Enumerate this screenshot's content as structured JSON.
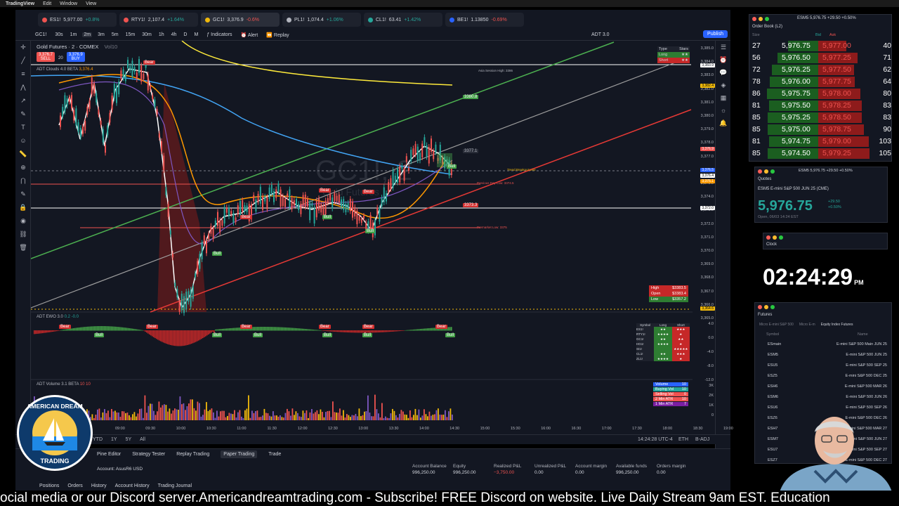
{
  "macbar": {
    "app": "TradingView",
    "menus": [
      "Edit",
      "Window",
      "View"
    ]
  },
  "tabs": [
    {
      "sym": "ES1!",
      "price": "5,977.00",
      "chg": "+0.8%",
      "color": "#ef5350",
      "dir": "up"
    },
    {
      "sym": "RTY1!",
      "price": "2,107.4",
      "chg": "+1.64%",
      "color": "#ef5350",
      "dir": "up"
    },
    {
      "sym": "GC1!",
      "price": "3,376.9",
      "chg": "-0.6%",
      "color": "#f0b90b",
      "dir": "dn"
    },
    {
      "sym": "PL1!",
      "price": "1,074.4",
      "chg": "+1.06%",
      "color": "#b2b5be",
      "dir": "up"
    },
    {
      "sym": "CL1!",
      "price": "63.41",
      "chg": "+1.42%",
      "color": "#26a69a",
      "dir": "up"
    },
    {
      "sym": "BE1!",
      "price": "1.13850",
      "chg": "-0.69%",
      "color": "#2962ff",
      "dir": "dn"
    }
  ],
  "toolbar": {
    "symbol": "GC1!",
    "intervals": [
      "30s",
      "1m",
      "2m",
      "3m",
      "5m",
      "15m",
      "30m",
      "1h",
      "4h",
      "D",
      "M"
    ],
    "selected_interval": "2m",
    "indicators": "Indicators",
    "alert": "Alert",
    "replay": "Replay",
    "layout": "ADT 3.0",
    "publish": "Publish"
  },
  "chart": {
    "title": "Gold Futures · 2 · COMEX",
    "sell_price": "3,376.7",
    "sell": "SELL",
    "qty": "20",
    "buy_price": "3,376.9",
    "buy": "BUY",
    "vol_label": "Vol10",
    "ind1": "ADT Clouds 4.0 BETA",
    "ind1_val": "3,376.4",
    "watermark": "GC1!, 2",
    "watermark_sub": "Gold Futures",
    "ind2": "ADT EWO 3.0",
    "ind2_vals": "0.2  -0.0",
    "ind3": "ADT Volume 3.1 BETA",
    "ind3_vals": "10  10",
    "line_labels": {
      "l1": "3380.8",
      "l2": "3377.1",
      "l3": "3373.3",
      "prev_day_low": "Previous Day Low: 3374.5",
      "premarket_low": "Premarket Low: 3375",
      "asia_high": "Asia Session High: 3386",
      "trend": "Trend Breakout Line"
    },
    "price_axis": [
      "3,385.0",
      "3,384.0",
      "3,383.0",
      "3,382.0",
      "3,381.0",
      "3,380.0",
      "3,379.0",
      "3,378.0",
      "3,377.0",
      "3,376.0",
      "3,375.0",
      "3,374.0",
      "3,373.0",
      "3,372.0",
      "3,371.0",
      "3,370.0",
      "3,369.0",
      "3,368.0",
      "3,367.0",
      "3,366.0",
      "3,365.0"
    ],
    "axis_labels": {
      "a": "3,383.9",
      "b": "3,382.4",
      "c": "3,376.9",
      "d": "3,376.5",
      "e": "3,376.4",
      "f": "3,375.1",
      "g": "3,372.0",
      "h": "3,364.6"
    },
    "ewo_axis": [
      "4.0",
      "0.0",
      "-4.0",
      "-8.0",
      "-12.0"
    ],
    "vol_axis": [
      "3K",
      "2K",
      "1K",
      "0"
    ],
    "time_axis": [
      "09:00",
      "09:30",
      "10:00",
      "10:30",
      "11:00",
      "11:30",
      "12:00",
      "12:30",
      "13:00",
      "13:30",
      "14:00",
      "14:30",
      "15:00",
      "15:30",
      "16:00",
      "16:30",
      "17:00",
      "17:30",
      "18:00",
      "18:30",
      "19:00"
    ],
    "hol": {
      "high_label": "High",
      "high": "$3383.5",
      "open_label": "Open",
      "open": "$3383.4",
      "low_label": "Low",
      "low": "$3357.2"
    },
    "stars": {
      "type": "Type",
      "stars": "Stars",
      "long": "Long",
      "short": "Short",
      "long_stars": "★★",
      "short_stars": "★★"
    },
    "vol_box": [
      {
        "label": "Volume",
        "val": "10",
        "bg": "#2962ff"
      },
      {
        "label": "Buying Vol",
        "val": "10",
        "bg": "#26a69a"
      },
      {
        "label": "Selling Vol",
        "val": "0",
        "bg": "#ef5350"
      },
      {
        "label": "2 Min ATR",
        "val": "10",
        "bg": "#ef5350"
      },
      {
        "label": "1 Min ATR",
        "val": "7",
        "bg": "#7b1fa2"
      }
    ],
    "symtable": {
      "head": [
        "Symbol",
        "Long",
        "Short"
      ],
      "rows": [
        [
          "ES1!",
          "★★",
          "★★★"
        ],
        [
          "RTY1!",
          "★★★★",
          "★"
        ],
        [
          "GC1!",
          "★★",
          "★★"
        ],
        [
          "HG1!",
          "★★★★",
          "★"
        ],
        [
          "SI1!",
          "",
          "★★★★★"
        ],
        [
          "CL1!",
          "★★",
          "★★★"
        ],
        [
          "ZL1!",
          "★★★★",
          "★"
        ]
      ]
    },
    "signals": {
      "bear": "Bear",
      "bull": "Bull"
    }
  },
  "bottombar": {
    "ranges": [
      "YTD",
      "1Y",
      "5Y",
      "All"
    ],
    "time": "14:24:28 UTC-4",
    "session": "ETH",
    "adj": "B-ADJ"
  },
  "panel": {
    "tabs": [
      "Pine Editor",
      "Strategy Tester",
      "Replay Trading",
      "Paper Trading",
      "Trade"
    ],
    "account_label": "Account: AsusR6 USD",
    "metrics": [
      {
        "label": "Account Balance",
        "val": "996,250.00"
      },
      {
        "label": "Equity",
        "val": "996,250.00"
      },
      {
        "label": "Realized P&L",
        "val": "−3,750.00"
      },
      {
        "label": "Unrealized P&L",
        "val": "0.00"
      },
      {
        "label": "Account margin",
        "val": "0.00"
      },
      {
        "label": "Available funds",
        "val": "996,250.00"
      },
      {
        "label": "Orders margin",
        "val": "0.00"
      }
    ],
    "subtabs": [
      "Positions",
      "Orders",
      "History",
      "Account History",
      "Trading Journal"
    ]
  },
  "orderbook": {
    "window_title": "ESM5 5,976.75 +29.50 +0.50%",
    "title": "Order Book (L2)",
    "cols": [
      "Size",
      "Bid",
      "Ask"
    ],
    "rows": [
      {
        "bsize": "27",
        "bid": "5,976.75",
        "ask": "5,977.00",
        "asize": "40"
      },
      {
        "bsize": "56",
        "bid": "5,976.50",
        "ask": "5,977.25",
        "asize": "71"
      },
      {
        "bsize": "72",
        "bid": "5,976.25",
        "ask": "5,977.50",
        "asize": "62"
      },
      {
        "bsize": "78",
        "bid": "5,976.00",
        "ask": "5,977.75",
        "asize": "64"
      },
      {
        "bsize": "86",
        "bid": "5,975.75",
        "ask": "5,978.00",
        "asize": "80"
      },
      {
        "bsize": "81",
        "bid": "5,975.50",
        "ask": "5,978.25",
        "asize": "83"
      },
      {
        "bsize": "85",
        "bid": "5,975.25",
        "ask": "5,978.50",
        "asize": "83"
      },
      {
        "bsize": "85",
        "bid": "5,975.00",
        "ask": "5,978.75",
        "asize": "90"
      },
      {
        "bsize": "81",
        "bid": "5,974.75",
        "ask": "5,979.00",
        "asize": "103"
      },
      {
        "bsize": "85",
        "bid": "5,974.50",
        "ask": "5,979.25",
        "asize": "105"
      }
    ]
  },
  "quotes": {
    "window_title": "ESM5 5,976.75 +29.50 +0.50%",
    "title": "Quotes",
    "desc": "ESM5 E-mini S&P 500 JUN 25 (CME)",
    "price": "5,976.75",
    "chg": "+29.50",
    "pct": "+0.50%",
    "status": "Open, 06/03 14:24 EST"
  },
  "clock": {
    "title": "Clock",
    "time": "02:24:29",
    "ampm": "PM"
  },
  "futures": {
    "title": "Futures",
    "filters": [
      "Micro E-mini S&P 500",
      "Micro E-m",
      "Equity Index Futures"
    ],
    "head": [
      "Symbol",
      "Name"
    ],
    "rows": [
      [
        "ESmain",
        "E-mini S&P 500 Main JUN 25"
      ],
      [
        "ESM5",
        "E-mini S&P 500 JUN 25"
      ],
      [
        "ESU5",
        "E-mini S&P 500 SEP 25"
      ],
      [
        "ESZ5",
        "E-mini S&P 500 DEC 25"
      ],
      [
        "ESH6",
        "E-mini S&P 500 MAR 26"
      ],
      [
        "ESM6",
        "E-mini S&P 500 JUN 26"
      ],
      [
        "ESU6",
        "E-mini S&P 500 SEP 26"
      ],
      [
        "ESZ6",
        "E-mini S&P 500 DEC 26"
      ],
      [
        "ESH7",
        "E-mini S&P 500 MAR 27"
      ],
      [
        "ESM7",
        "E-mini S&P 500 JUN 27"
      ],
      [
        "ESU7",
        "E-mini S&P 500 SEP 27"
      ],
      [
        "ESZ7",
        "E-mini S&P 500 DEC 27"
      ]
    ]
  },
  "logo": {
    "top": "AMERICAN DREAM",
    "bottom": "TRADING"
  },
  "ticker": "ocial media or our Discord server.Americandreamtrading.com - Subscribe! FREE Discord on website. Live Daily Stream 9am EST. Education"
}
